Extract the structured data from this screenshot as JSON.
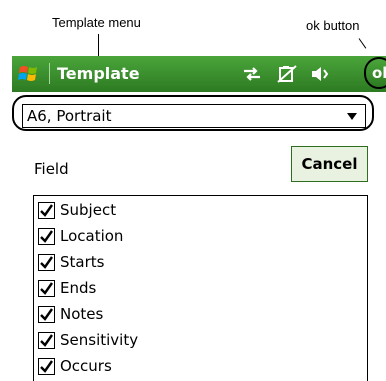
{
  "annotations": {
    "template_menu_label": "Template menu",
    "ok_button_label": "ok button"
  },
  "titlebar": {
    "title": "Template",
    "icons": [
      "windows-logo",
      "connectivity-icon",
      "battery-icon",
      "volume-icon"
    ],
    "ok_label": "ok",
    "color": "#3c9630"
  },
  "template_menu": {
    "selected": "A6, Portrait"
  },
  "field_section": {
    "label": "Field",
    "cancel_label": "Cancel",
    "items": [
      {
        "label": "Subject",
        "checked": true
      },
      {
        "label": "Location",
        "checked": true
      },
      {
        "label": "Starts",
        "checked": true
      },
      {
        "label": "Ends",
        "checked": true
      },
      {
        "label": "Notes",
        "checked": true
      },
      {
        "label": "Sensitivity",
        "checked": true
      },
      {
        "label": "Occurs",
        "checked": true
      }
    ]
  }
}
